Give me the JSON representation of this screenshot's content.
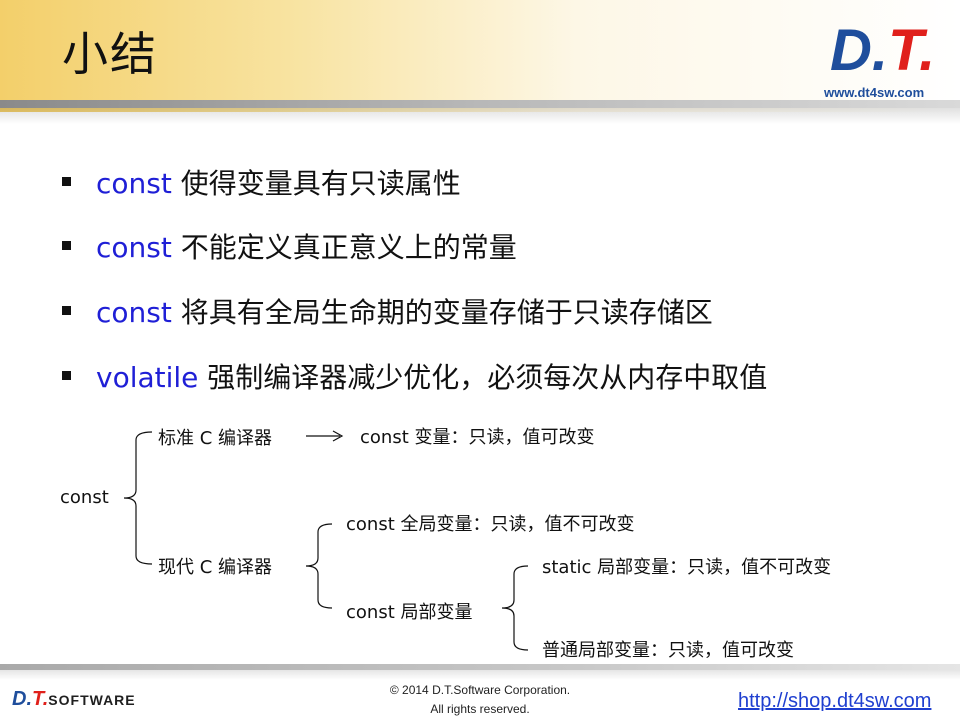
{
  "header": {
    "title": "小结",
    "logo_main": "D.",
    "logo_red": "T",
    "logo_end": ".",
    "logo_url": "www.dt4sw.com"
  },
  "bullets": [
    {
      "keyword": "const",
      "text": " 使得变量具有只读属性"
    },
    {
      "keyword": "const",
      "text": " 不能定义真正意义上的常量"
    },
    {
      "keyword": "const",
      "text": " 将具有全局生命期的变量存储于只读存储区"
    },
    {
      "keyword": "volatile",
      "text": " 强制编译器减少优化，必须每次从内存中取值"
    }
  ],
  "diagram": {
    "root": "const",
    "standard": "标准 C 编译器",
    "standard_result": "const 变量：只读，值可改变",
    "modern": "现代 C 编译器",
    "global": "const 全局变量：只读，值不可改变",
    "local": "const 局部变量",
    "static_local": "static 局部变量：只读，值不可改变",
    "normal_local": "普通局部变量：只读，值可改变"
  },
  "footer": {
    "logo_d": "D.",
    "logo_t": "T",
    "logo_dot": ".",
    "logo_soft": "SOFTWARE",
    "copyright": "© 2014 D.T.Software Corporation.",
    "rights": "All rights reserved.",
    "link": "http://shop.dt4sw.com"
  }
}
